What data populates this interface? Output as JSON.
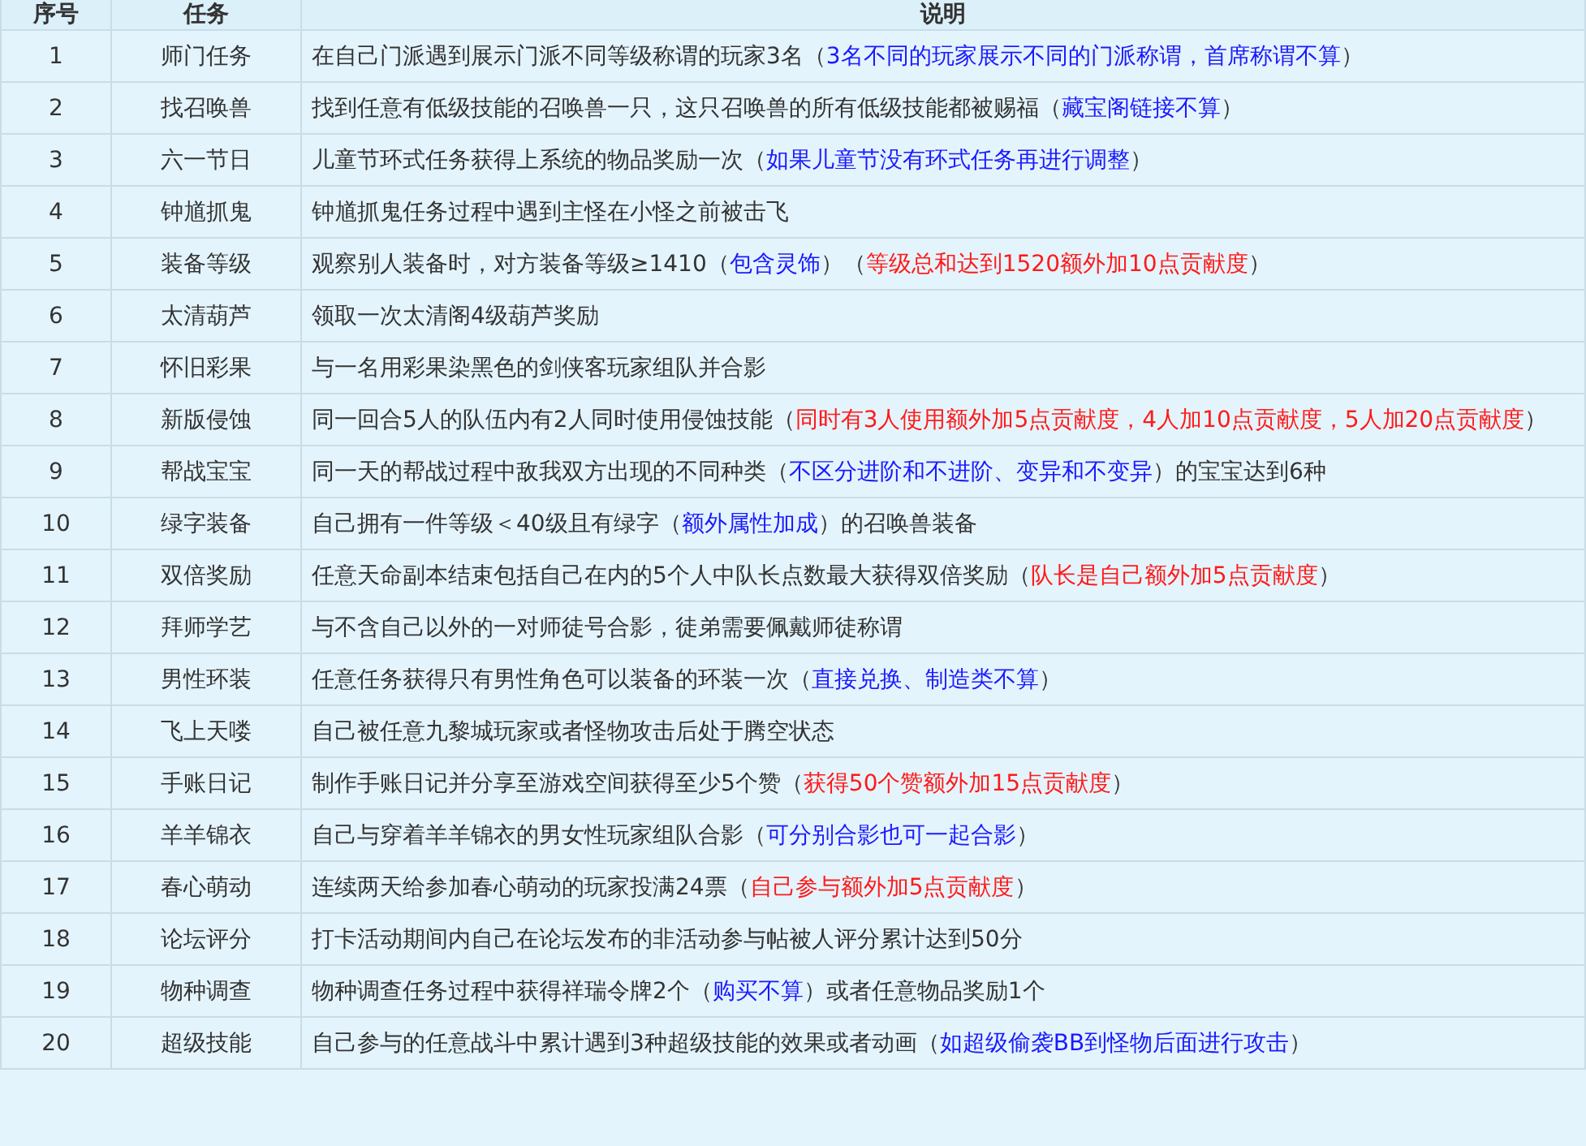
{
  "table": {
    "columns": [
      "序号",
      "任务",
      "说明"
    ],
    "rows": [
      {
        "number": "1",
        "task": "师门任务",
        "description": [
          {
            "text": "在自己门派遇到展示门派不同等级称谓的玩家3名（",
            "color": "#333333"
          },
          {
            "text": "3名不同的玩家展示不同的门派称谓，首席称谓不算",
            "color": "#1a1aff"
          },
          {
            "text": "）",
            "color": "#333333"
          }
        ]
      },
      {
        "number": "2",
        "task": "找召唤兽",
        "description": [
          {
            "text": "找到任意有低级技能的召唤兽一只，这只召唤兽的所有低级技能都被赐福（",
            "color": "#333333"
          },
          {
            "text": "藏宝阁链接不算",
            "color": "#1a1aff"
          },
          {
            "text": "）",
            "color": "#333333"
          }
        ]
      },
      {
        "number": "3",
        "task": "六一节日",
        "description": [
          {
            "text": "儿童节环式任务获得上系统的物品奖励一次（",
            "color": "#333333"
          },
          {
            "text": "如果儿童节没有环式任务再进行调整",
            "color": "#1a1aff"
          },
          {
            "text": "）",
            "color": "#333333"
          }
        ]
      },
      {
        "number": "4",
        "task": "钟馗抓鬼",
        "description": [
          {
            "text": "钟馗抓鬼任务过程中遇到主怪在小怪之前被击飞",
            "color": "#333333"
          }
        ]
      },
      {
        "number": "5",
        "task": "装备等级",
        "description": [
          {
            "text": "观察别人装备时，对方装备等级≥1410（",
            "color": "#333333"
          },
          {
            "text": "包含灵饰",
            "color": "#1a1aff"
          },
          {
            "text": "）（",
            "color": "#333333"
          },
          {
            "text": "等级总和达到1520额外加10点贡献度",
            "color": "#ff1a1a"
          },
          {
            "text": "）",
            "color": "#333333"
          }
        ]
      },
      {
        "number": "6",
        "task": "太清葫芦",
        "description": [
          {
            "text": "领取一次太清阁4级葫芦奖励",
            "color": "#333333"
          }
        ]
      },
      {
        "number": "7",
        "task": "怀旧彩果",
        "description": [
          {
            "text": "与一名用彩果染黑色的剑侠客玩家组队并合影",
            "color": "#333333"
          }
        ]
      },
      {
        "number": "8",
        "task": "新版侵蚀",
        "description": [
          {
            "text": "同一回合5人的队伍内有2人同时使用侵蚀技能（",
            "color": "#333333"
          },
          {
            "text": "同时有3人使用额外加5点贡献度，4人加10点贡献度，5人加20点贡献度",
            "color": "#ff1a1a"
          },
          {
            "text": "）",
            "color": "#333333"
          }
        ]
      },
      {
        "number": "9",
        "task": "帮战宝宝",
        "description": [
          {
            "text": "同一天的帮战过程中敌我双方出现的不同种类（",
            "color": "#333333"
          },
          {
            "text": "不区分进阶和不进阶、变异和不变异",
            "color": "#1a1aff"
          },
          {
            "text": "）的宝宝达到6种",
            "color": "#333333"
          }
        ]
      },
      {
        "number": "10",
        "task": "绿字装备",
        "description": [
          {
            "text": "自己拥有一件等级＜40级且有绿字（",
            "color": "#333333"
          },
          {
            "text": "额外属性加成",
            "color": "#1a1aff"
          },
          {
            "text": "）的召唤兽装备",
            "color": "#333333"
          }
        ]
      },
      {
        "number": "11",
        "task": "双倍奖励",
        "description": [
          {
            "text": "任意天命副本结束包括自己在内的5个人中队长点数最大获得双倍奖励（",
            "color": "#333333"
          },
          {
            "text": "队长是自己额外加5点贡献度",
            "color": "#ff1a1a"
          },
          {
            "text": "）",
            "color": "#333333"
          }
        ]
      },
      {
        "number": "12",
        "task": "拜师学艺",
        "description": [
          {
            "text": "与不含自己以外的一对师徒号合影，徒弟需要佩戴师徒称谓",
            "color": "#333333"
          }
        ]
      },
      {
        "number": "13",
        "task": "男性环装",
        "description": [
          {
            "text": "任意任务获得只有男性角色可以装备的环装一次（",
            "color": "#333333"
          },
          {
            "text": "直接兑换、制造类不算",
            "color": "#1a1aff"
          },
          {
            "text": "）",
            "color": "#333333"
          }
        ]
      },
      {
        "number": "14",
        "task": "飞上天喽",
        "description": [
          {
            "text": "自己被任意九黎城玩家或者怪物攻击后处于腾空状态",
            "color": "#333333"
          }
        ]
      },
      {
        "number": "15",
        "task": "手账日记",
        "description": [
          {
            "text": "制作手账日记并分享至游戏空间获得至少5个赞（",
            "color": "#333333"
          },
          {
            "text": "获得50个赞额外加15点贡献度",
            "color": "#ff1a1a"
          },
          {
            "text": "）",
            "color": "#333333"
          }
        ]
      },
      {
        "number": "16",
        "task": "羊羊锦衣",
        "description": [
          {
            "text": "自己与穿着羊羊锦衣的男女性玩家组队合影（",
            "color": "#333333"
          },
          {
            "text": "可分别合影也可一起合影",
            "color": "#1a1aff"
          },
          {
            "text": "）",
            "color": "#333333"
          }
        ]
      },
      {
        "number": "17",
        "task": "春心萌动",
        "description": [
          {
            "text": "连续两天给参加春心萌动的玩家投满24票（",
            "color": "#333333"
          },
          {
            "text": "自己参与额外加5点贡献度",
            "color": "#ff1a1a"
          },
          {
            "text": "）",
            "color": "#333333"
          }
        ]
      },
      {
        "number": "18",
        "task": "论坛评分",
        "description": [
          {
            "text": "打卡活动期间内自己在论坛发布的非活动参与帖被人评分累计达到50分",
            "color": "#333333"
          }
        ]
      },
      {
        "number": "19",
        "task": "物种调查",
        "description": [
          {
            "text": "物种调查任务过程中获得祥瑞令牌2个（",
            "color": "#333333"
          },
          {
            "text": "购买不算",
            "color": "#1a1aff"
          },
          {
            "text": "）或者任意物品奖励1个",
            "color": "#333333"
          }
        ]
      },
      {
        "number": "20",
        "task": "超级技能",
        "description": [
          {
            "text": "自己参与的任意战斗中累计遇到3种超级技能的效果或者动画（",
            "color": "#333333"
          },
          {
            "text": "如超级偷袭BB到怪物后面进行攻击",
            "color": "#1a1aff"
          },
          {
            "text": "）",
            "color": "#333333"
          }
        ]
      }
    ]
  }
}
